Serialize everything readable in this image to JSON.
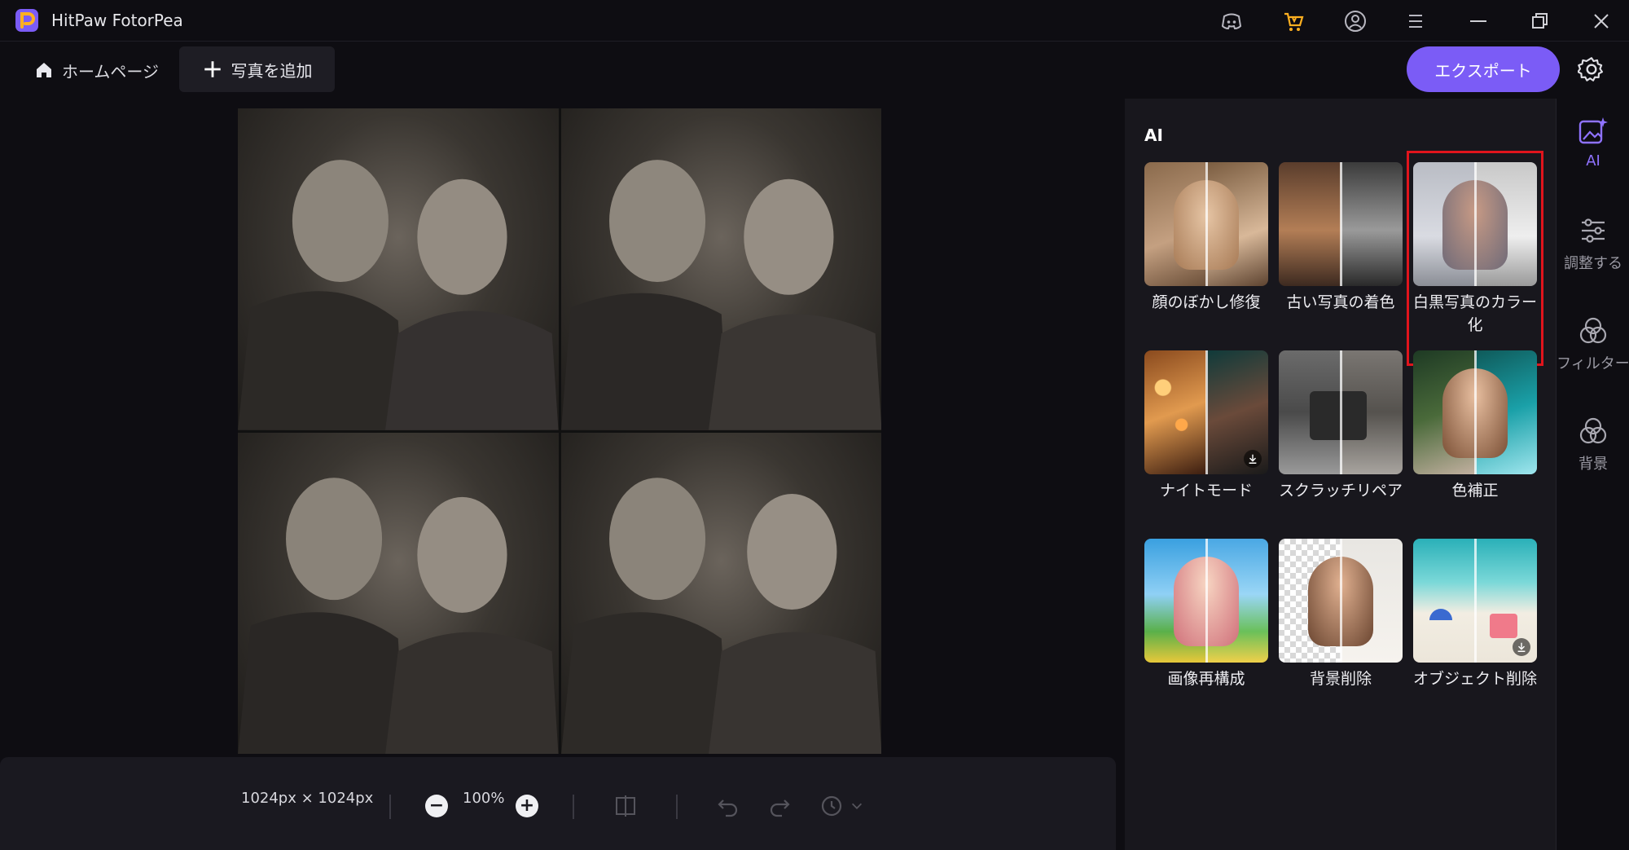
{
  "app": {
    "title": "HitPaw FotorPea",
    "brand_color": "#7b5cf6"
  },
  "titlebar_icons": [
    "discord-icon",
    "shop-icon",
    "account-icon",
    "menu-icon",
    "minimize-icon",
    "restore-icon",
    "close-icon"
  ],
  "toolbar": {
    "home_label": "ホームページ",
    "add_photo_label": "写真を追加",
    "export_label": "エクスポート"
  },
  "canvas": {
    "dimensions": "1024px × 1024px",
    "zoom": "100%"
  },
  "panel": {
    "title": "AI",
    "tools": [
      {
        "label": "顔のぼかし修復"
      },
      {
        "label": "古い写真の着色"
      },
      {
        "label": "白黒写真のカラー化",
        "highlighted": true
      },
      {
        "label": "ナイトモード"
      },
      {
        "label": "スクラッチリペア"
      },
      {
        "label": "色補正"
      },
      {
        "label": "画像再構成"
      },
      {
        "label": "背景削除"
      },
      {
        "label": "オブジェクト削除"
      }
    ],
    "highlight_color": "#e0141c"
  },
  "nav_rail": {
    "items": [
      {
        "label": "AI",
        "active": true
      },
      {
        "label": "調整する"
      },
      {
        "label": "フィルター"
      },
      {
        "label": "背景"
      }
    ]
  }
}
